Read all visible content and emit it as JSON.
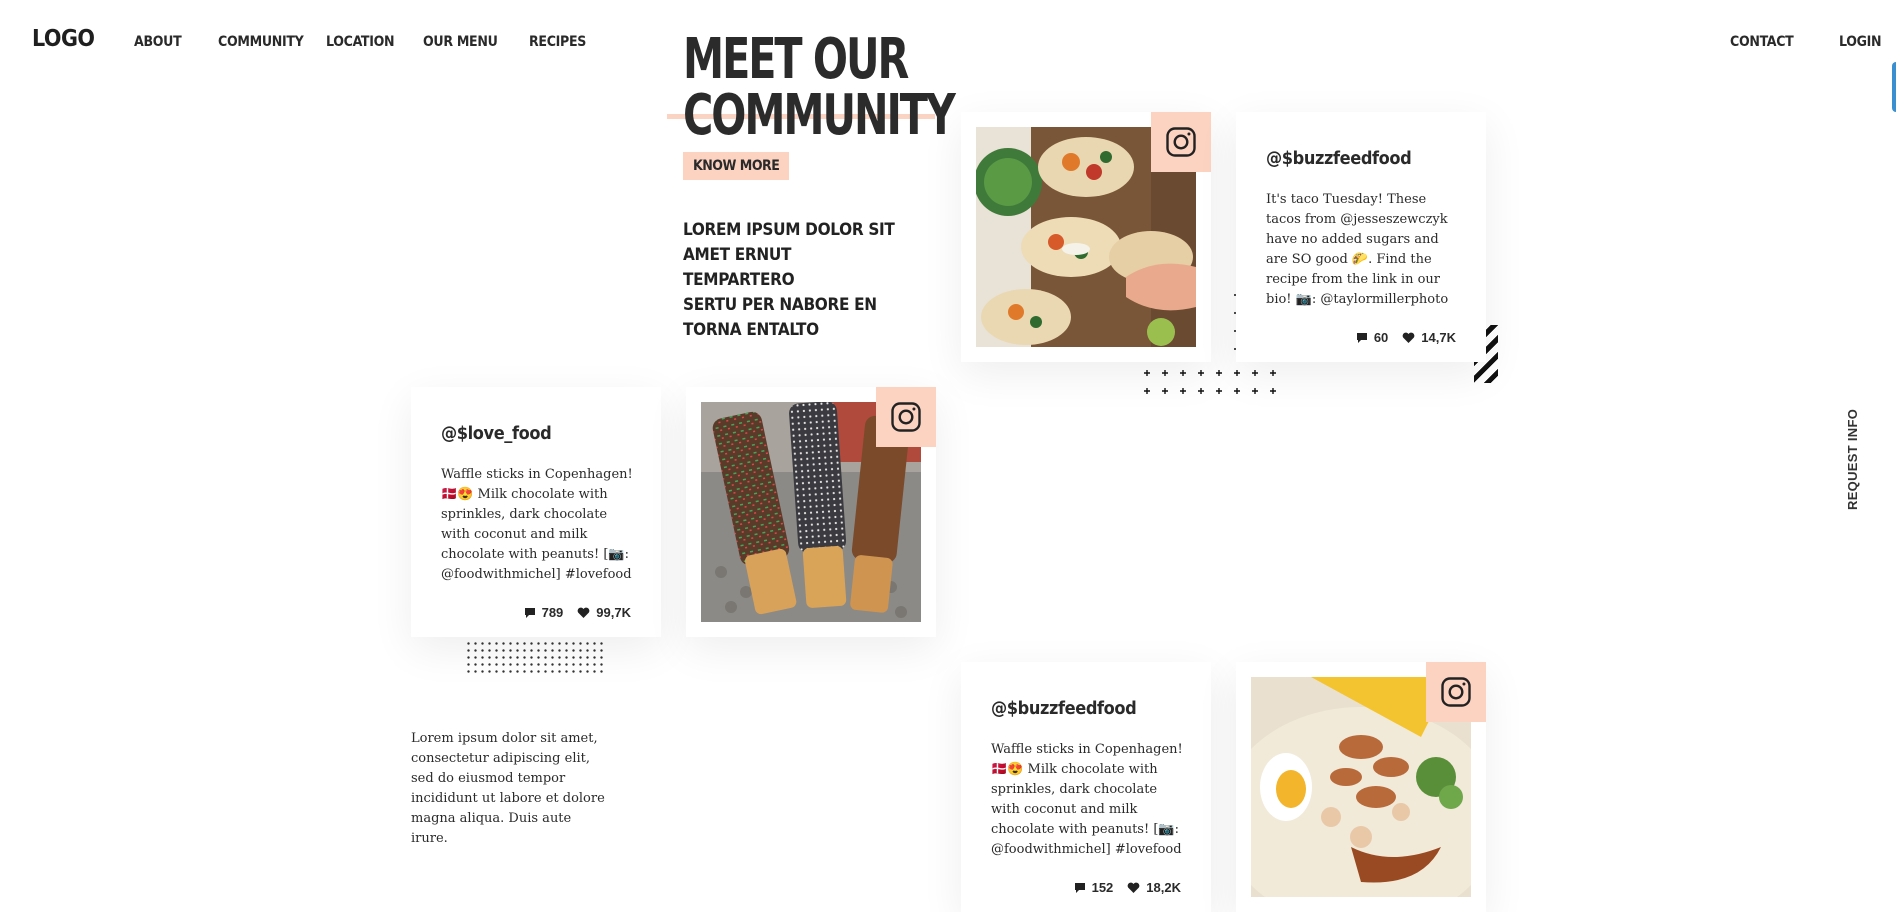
{
  "header": {
    "logo": "LOGO",
    "nav_left": [
      "ABOUT",
      "COMMUNITY",
      "LOCATION",
      "OUR MENU",
      "RECIPES"
    ],
    "nav_right": [
      "CONTACT",
      "LOGIN"
    ]
  },
  "hero": {
    "title_line1": "MEET OUR",
    "title_line2": "COMMUNITY",
    "know_more": "KNOW MORE",
    "subtitle": "LOREM IPSUM DOLOR SIT\nAMET ERNUT TEMPARTERO\nSERTU PER NABORE EN\nTORNA ENTALTO"
  },
  "posts": [
    {
      "handle": "@$buzzfeedfood",
      "caption": "It's taco Tuesday! These tacos from @jesseszewczyk have no added sugars and are SO good 🌮. Find the recipe from the link in our bio! 📷: @taylormillerphoto",
      "comments": "60",
      "likes": "14,7K",
      "photo": "tacos"
    },
    {
      "handle": "@$love_food",
      "caption": "Waffle sticks in Copenhagen! 🇩🇰😍 Milk chocolate with sprinkles, dark chocolate with coconut and milk chocolate with peanuts! [📷: @foodwithmichel] #lovefood",
      "comments": "789",
      "likes": "99,7K",
      "photo": "waffle-sticks"
    },
    {
      "handle": "@$buzzfeedfood",
      "caption": "Waffle sticks in Copenhagen! 🇩🇰😍 Milk chocolate with sprinkles, dark chocolate with coconut and milk chocolate with peanuts! [📷: @foodwithmichel] #lovefood",
      "comments": "152",
      "likes": "18,2K",
      "photo": "seafood-noodles"
    }
  ],
  "lorem": "Lorem ipsum dolor sit amet, consectetur adipiscing elit, sed do eiusmod tempor incididunt ut labore et dolore magna aliqua. Duis aute irure.",
  "side_cta": "REQUEST INFO",
  "colors": {
    "accent": "#fcd2c1",
    "text": "#2a2a2a"
  }
}
